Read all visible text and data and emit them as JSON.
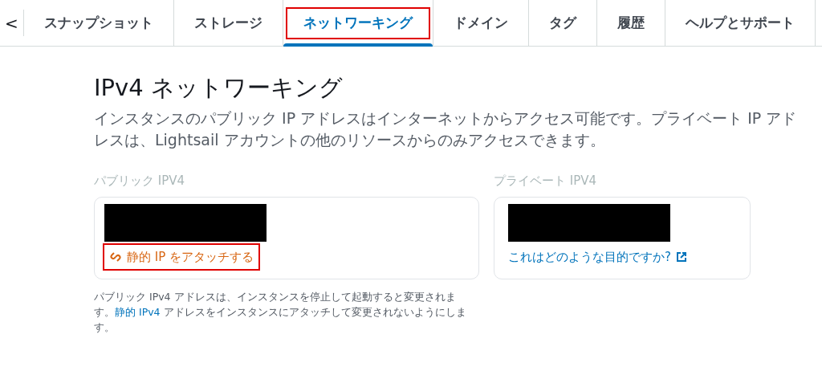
{
  "back_button": "<",
  "tabs": [
    {
      "label": "スナップショット",
      "selected": false,
      "highlighted": false
    },
    {
      "label": "ストレージ",
      "selected": false,
      "highlighted": false
    },
    {
      "label": "ネットワーキング",
      "selected": true,
      "highlighted": true
    },
    {
      "label": "ドメイン",
      "selected": false,
      "highlighted": false
    },
    {
      "label": "タグ",
      "selected": false,
      "highlighted": false
    },
    {
      "label": "履歴",
      "selected": false,
      "highlighted": false
    },
    {
      "label": "ヘルプとサポート",
      "selected": false,
      "highlighted": false
    }
  ],
  "heading": "IPv4 ネットワーキング",
  "description": "インスタンスのパブリック IP アドレスはインターネットからアクセス可能です。プライベート IP アドレスは、Lightsail アカウントの他のリソースからのみアクセスできます。",
  "public": {
    "label": "パブリック IPV4",
    "address_redacted": true,
    "link": "静的 IP をアタッチする",
    "link_highlighted": true,
    "note_before": "パブリック IPv4 アドレスは、インスタンスを停止して起動すると変更されます。",
    "note_link": "静的 IPv4",
    "note_after": " アドレスをインスタンスにアタッチして変更されないようにします。"
  },
  "private": {
    "label": "プライベート IPV4",
    "address_redacted": true,
    "link": "これはどのような目的ですか?"
  }
}
